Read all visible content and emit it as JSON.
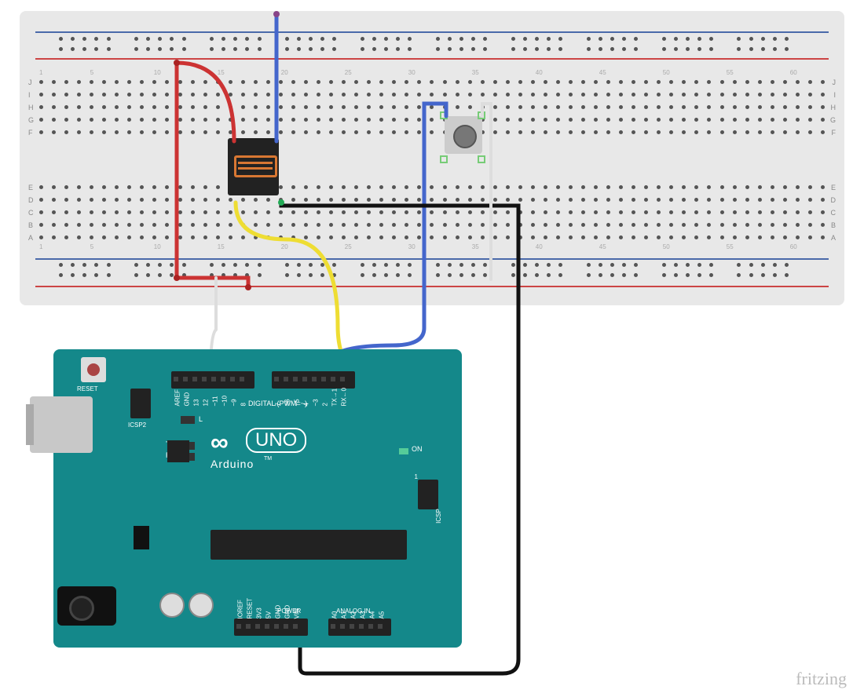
{
  "diagram_type": "electronic-circuit-wiring",
  "tool": "fritzing",
  "components": {
    "breadboard": {
      "type": "full-size-breadboard",
      "row_labels_left": [
        "A",
        "B",
        "C",
        "D",
        "E",
        "F",
        "G",
        "H",
        "I",
        "J"
      ],
      "row_labels_right": [
        "A",
        "B",
        "C",
        "D",
        "E",
        "F",
        "G",
        "H",
        "I",
        "J"
      ],
      "column_numbers": [
        1,
        5,
        10,
        15,
        20,
        25,
        30,
        35,
        40,
        45,
        50,
        55,
        60
      ],
      "power_rails": [
        "+",
        "−",
        "+",
        "−"
      ]
    },
    "arduino": {
      "model": "Arduino UNO",
      "brand_text": "Arduino",
      "logo_label": "UNO",
      "reset_label": "RESET",
      "icsp2_label": "ICSP2",
      "icsp_label": "ICSP",
      "digital_label": "DIGITAL (PWM=~)",
      "power_label": "POWER",
      "analog_label": "ANALOG IN",
      "on_label": "ON",
      "tx_label": "TX",
      "rx_label": "RX",
      "l_label": "L",
      "tm_label": "TM",
      "tx_arrow": "TX→1",
      "rx_arrow": "RX←0",
      "digital_pins_upper": [
        "AREF",
        "GND",
        "13",
        "12",
        "~11",
        "~10",
        "~9",
        "8"
      ],
      "digital_pins_lower": [
        "7",
        "~6",
        "~5",
        "4",
        "~3",
        "2"
      ],
      "power_pins": [
        "IOREF",
        "RESET",
        "3V3",
        "5V",
        "GND",
        "GND",
        "VIN"
      ],
      "analog_pins": [
        "A0",
        "A1",
        "A2",
        "A3",
        "A4",
        "A5"
      ],
      "icsp_pin1": "1"
    },
    "relay": {
      "type": "SPDT Relay",
      "position": "breadboard columns 17-21 across center gap"
    },
    "pushbutton": {
      "type": "tactile-pushbutton",
      "position": "breadboard columns 33-35 across center gap"
    }
  },
  "connections": [
    {
      "color": "red",
      "from": "relay top-left pin",
      "to": "breadboard lower – rail",
      "desc": "relay COM to – rail"
    },
    {
      "color": "red",
      "from": "breadboard lower – rail col 17",
      "to": "breadboard lower + rail col 17",
      "desc": "rail jumper"
    },
    {
      "color": "blue",
      "from": "relay top-right pin",
      "to": "breadboard – rail",
      "via": "blue wire up then across"
    },
    {
      "color": "yellow",
      "from": "relay bottom-left pin",
      "to": "Arduino D7"
    },
    {
      "color": "blue",
      "from": "Arduino D8",
      "to": "breadboard button left col 33",
      "desc": "digital read button"
    },
    {
      "color": "black",
      "from": "relay bottom-right pin (GND)",
      "to": "Arduino GND (power header)"
    },
    {
      "color": "white/gray",
      "from": "Arduino D13",
      "to": "breadboard lower – rail",
      "desc": "short jumper"
    },
    {
      "color": "white/gray",
      "from": "pushbutton right pin",
      "to": "breadboard lower – rail col 35",
      "desc": "button to rail"
    }
  ],
  "watermark": "fritzing"
}
